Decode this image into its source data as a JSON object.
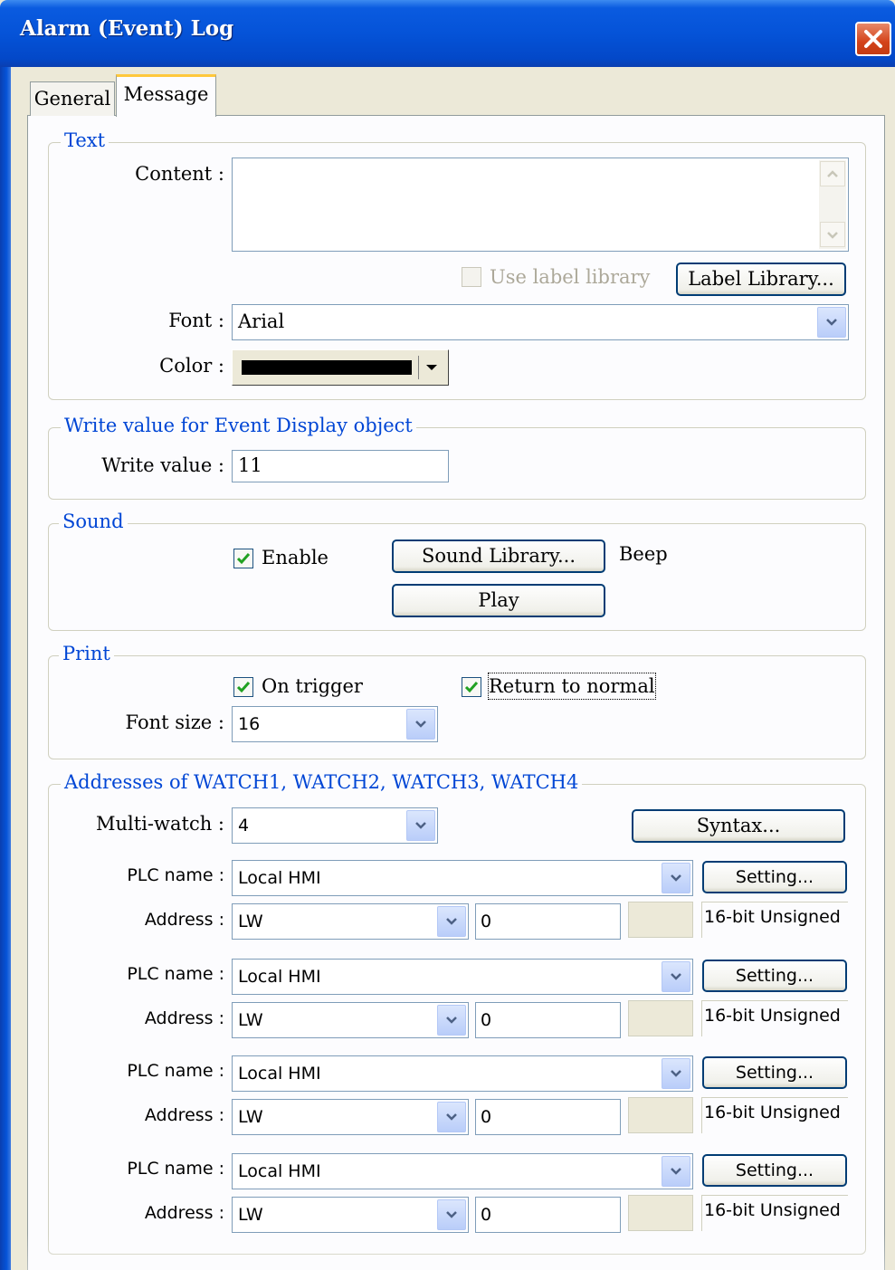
{
  "window": {
    "title": "Alarm (Event) Log"
  },
  "tabs": [
    {
      "label": "General"
    },
    {
      "label": "Message"
    }
  ],
  "text_group": {
    "legend": "Text",
    "content_label": "Content :",
    "content_value": "",
    "use_label_library": "Use label library",
    "label_library_button": "Label Library...",
    "font_label": "Font :",
    "font_value": "Arial",
    "color_label": "Color :",
    "color_value": "#000000"
  },
  "write_group": {
    "legend": "Write value for Event Display object",
    "write_value_label": "Write value :",
    "write_value": "11"
  },
  "sound_group": {
    "legend": "Sound",
    "enable_label": "Enable",
    "enable_checked": true,
    "sound_library_button": "Sound Library...",
    "sound_name": "Beep",
    "play_button": "Play"
  },
  "print_group": {
    "legend": "Print",
    "on_trigger_label": "On trigger",
    "on_trigger_checked": true,
    "return_normal_label": "Return to normal",
    "return_normal_checked": true,
    "font_size_label": "Font size :",
    "font_size_value": "16"
  },
  "watch_group": {
    "legend": "Addresses of WATCH1, WATCH2, WATCH3, WATCH4",
    "multi_watch_label": "Multi-watch :",
    "multi_watch_value": "4",
    "syntax_button": "Syntax...",
    "plc_label": "PLC name :",
    "address_label": "Address :",
    "rows": [
      {
        "plc": "Local HMI",
        "setting": "Setting...",
        "device": "LW",
        "address": "0",
        "type": "16-bit Unsigned"
      },
      {
        "plc": "Local HMI",
        "setting": "Setting...",
        "device": "LW",
        "address": "0",
        "type": "16-bit Unsigned"
      },
      {
        "plc": "Local HMI",
        "setting": "Setting...",
        "device": "LW",
        "address": "0",
        "type": "16-bit Unsigned"
      },
      {
        "plc": "Local HMI",
        "setting": "Setting...",
        "device": "LW",
        "address": "0",
        "type": "16-bit Unsigned"
      }
    ]
  },
  "colors": {
    "titlebar": "#0553d8",
    "legend_text": "#0046d5",
    "dialog_bg": "#ece9d8",
    "check_mark": "#21a121"
  }
}
